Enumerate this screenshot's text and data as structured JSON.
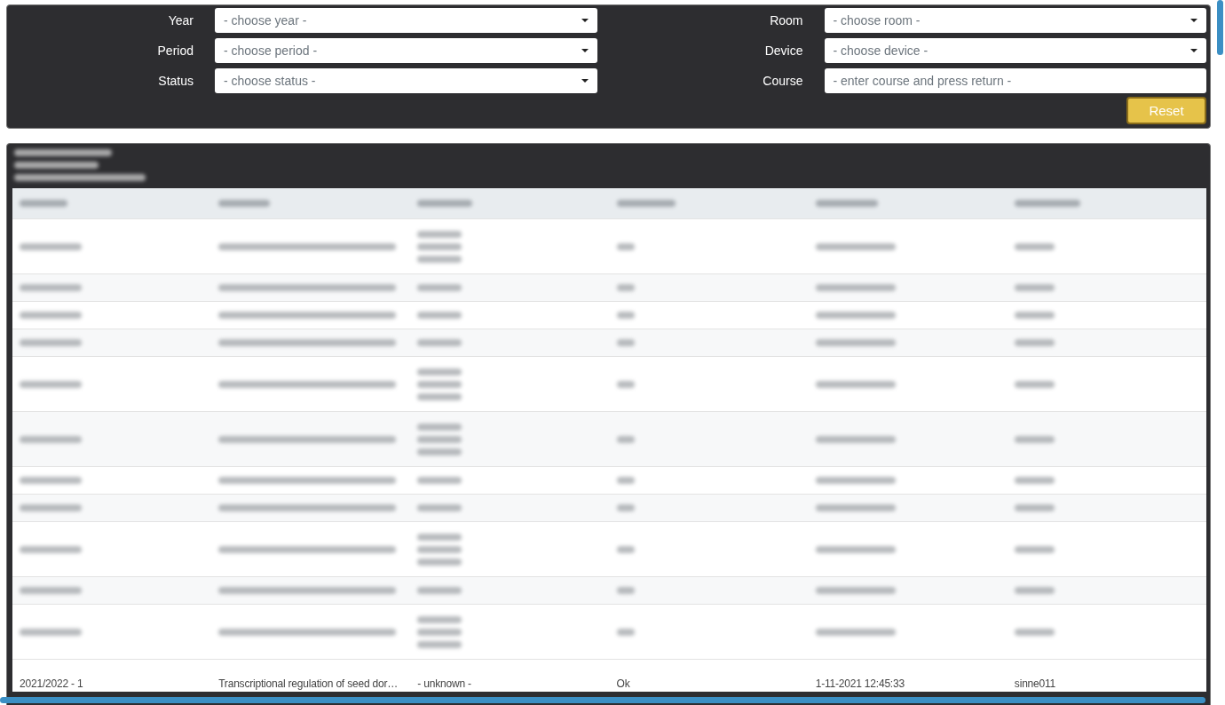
{
  "filters": [
    {
      "label": "Year",
      "kind": "select",
      "placeholder": "- choose year -"
    },
    {
      "label": "Room",
      "kind": "select",
      "placeholder": "- choose room -"
    },
    {
      "label": "Period",
      "kind": "select",
      "placeholder": "- choose period -"
    },
    {
      "label": "Device",
      "kind": "select",
      "placeholder": "- choose device -"
    },
    {
      "label": "Status",
      "kind": "select",
      "placeholder": "- choose status -"
    },
    {
      "label": "Course",
      "kind": "text",
      "placeholder": "- enter course and press return -"
    }
  ],
  "reset_button": "Reset",
  "blurred_rows": [
    {
      "kind": "tall"
    },
    {
      "kind": "short"
    },
    {
      "kind": "short"
    },
    {
      "kind": "short"
    },
    {
      "kind": "tall"
    },
    {
      "kind": "tall"
    },
    {
      "kind": "short"
    },
    {
      "kind": "short"
    },
    {
      "kind": "tall"
    },
    {
      "kind": "short"
    },
    {
      "kind": "tall"
    }
  ],
  "last_row": [
    "2021/2022 - 1",
    "Transcriptional regulation of seed dor…",
    "- unknown -",
    "Ok",
    "1-11-2021 12:45:33",
    "sinne011"
  ]
}
